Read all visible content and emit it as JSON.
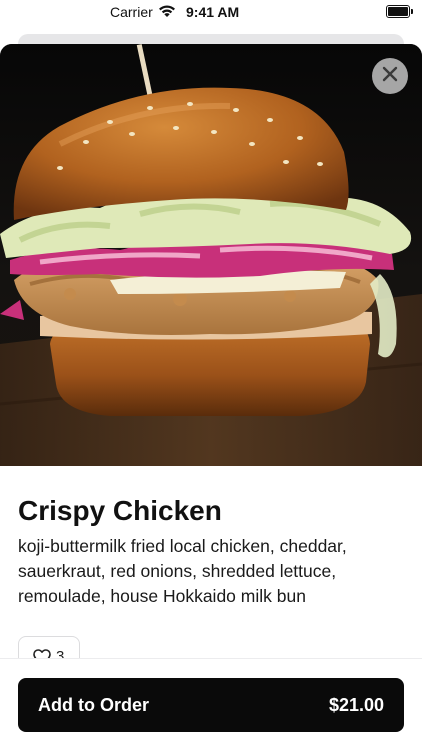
{
  "status_bar": {
    "carrier": "Carrier",
    "time": "9:41 AM"
  },
  "item": {
    "title": "Crispy Chicken",
    "description": "koji-buttermilk fried local chicken, cheddar, sauerkraut, red onions, shredded lettuce, remoulade, house Hokkaido milk bun",
    "like_count": "3"
  },
  "order": {
    "label": "Add to Order",
    "price": "$21.00"
  },
  "icons": {
    "close": "close-icon",
    "heart": "heart-icon",
    "wifi": "wifi-icon",
    "battery": "battery-icon"
  },
  "colors": {
    "button_bg": "#0a0a0a",
    "button_text": "#ffffff",
    "close_bg": "#b4b4b4"
  }
}
